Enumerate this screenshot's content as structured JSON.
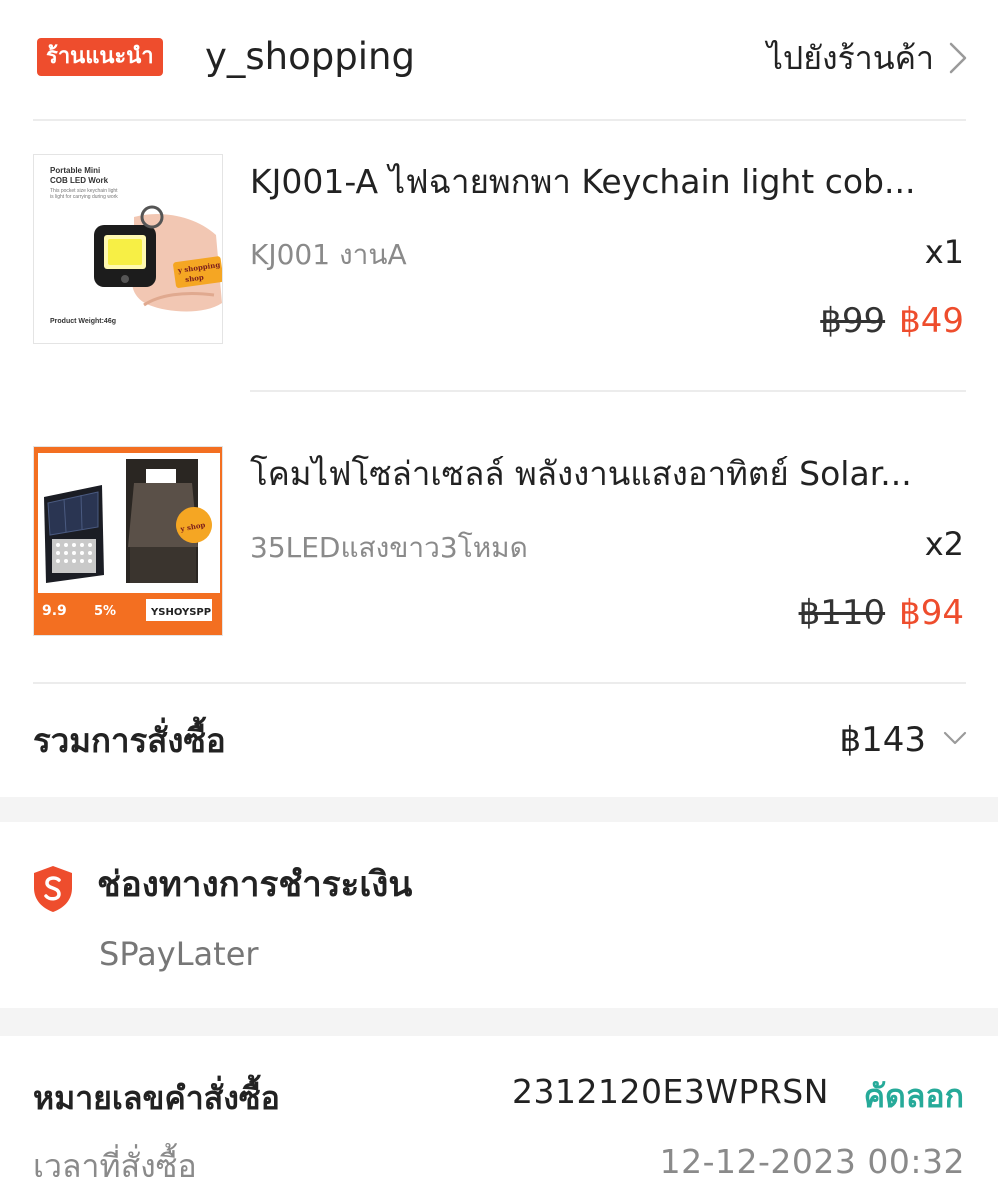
{
  "shop": {
    "badge": "ร้านแนะนำ",
    "name": "y_shopping",
    "go_to_shop": "ไปยังร้านค้า"
  },
  "products": [
    {
      "name": "KJ001-A ไฟฉายพกพา Keychain light cob...",
      "variant": "KJ001 งานA",
      "quantity": "x1",
      "original_price": "฿99",
      "sale_price": "฿49",
      "thumb_text": {
        "title1": "Portable Mini",
        "title2": "COB LED Work",
        "desc1": "This pocket size keychain light",
        "desc2": "is light for carrying during work",
        "sticker1": "y shopping",
        "sticker2": "shop",
        "weight": "Product Weight:46g"
      }
    },
    {
      "name": "โคมไฟโซล่าเซลล์ พลังงานแสงอาทิตย์ Solar...",
      "variant": "35LEDแสงขาว3โหมด",
      "quantity": "x2",
      "original_price": "฿110",
      "sale_price": "฿94",
      "thumb_text": {
        "promo_date": "9.9",
        "promo_discount": "5%",
        "promo_code": "YSHOYSPP",
        "sticker": "y shop"
      }
    }
  ],
  "order_total": {
    "label": "รวมการสั่งซื้อ",
    "value": "฿143"
  },
  "payment": {
    "title": "ช่องทางการชำระเงิน",
    "method": "SPayLater"
  },
  "order_info": {
    "order_number_label": "หมายเลขคำสั่งซื้อ",
    "order_number": "2312120E3WPRSN",
    "copy_label": "คัดลอก",
    "order_time_label": "เวลาที่สั่งซื้อ",
    "order_time": "12-12-2023 00:32"
  },
  "colors": {
    "accent": "#ee4d2d",
    "copy": "#26aa99"
  }
}
